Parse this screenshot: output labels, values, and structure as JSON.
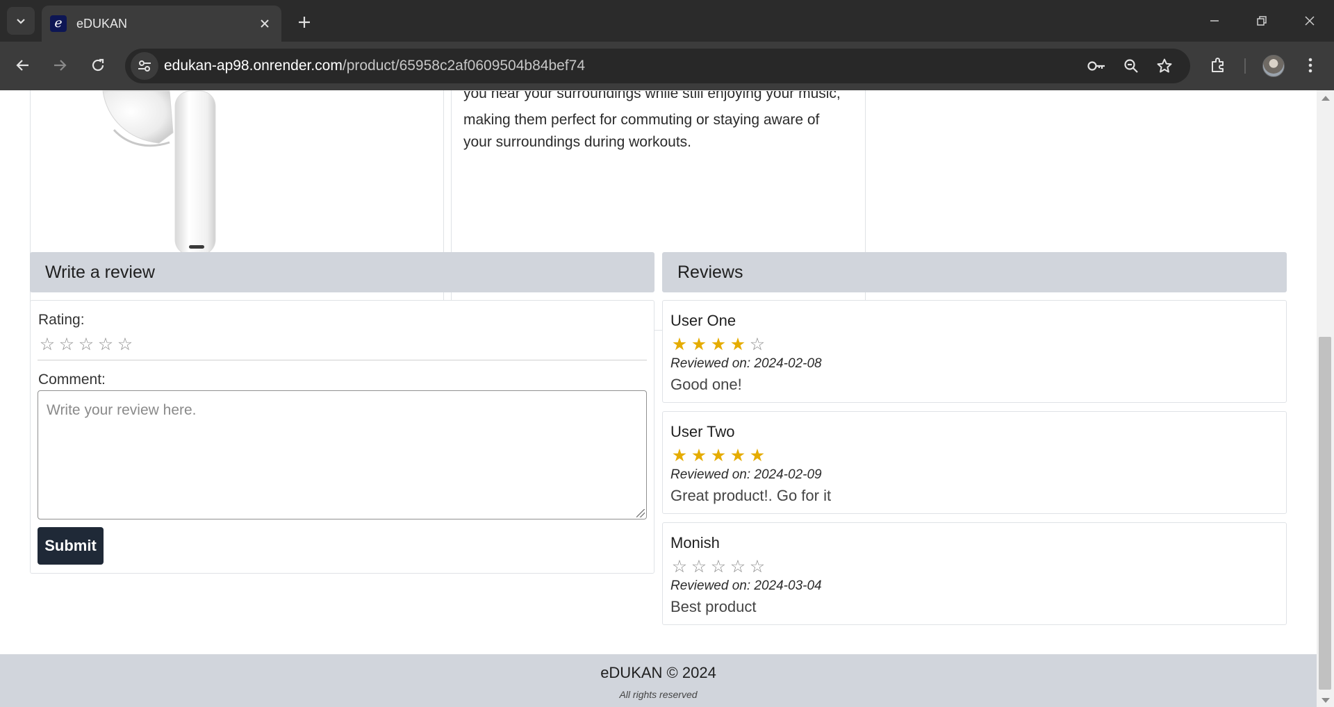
{
  "browser": {
    "tab_title": "eDUKAN",
    "favicon_letter": "e",
    "url_host": "edukan-ap98.onrender.com",
    "url_path": "/product/65958c2af0609504b84bef74"
  },
  "product": {
    "description_lines": [
      "you hear your surroundings while still enjoying your music,",
      "making them perfect for commuting or staying aware of",
      "your surroundings during workouts."
    ]
  },
  "write_review": {
    "header": "Write a review",
    "rating_label": "Rating:",
    "rating_value": 0,
    "comment_label": "Comment:",
    "comment_placeholder": "Write your review here.",
    "submit_label": "Submit"
  },
  "reviews": {
    "header": "Reviews",
    "items": [
      {
        "name": "User One",
        "rating": 4,
        "date": "Reviewed on: 2024-02-08",
        "comment": "Good one!"
      },
      {
        "name": "User Two",
        "rating": 5,
        "date": "Reviewed on: 2024-02-09",
        "comment": "Great product!. Go for it"
      },
      {
        "name": "Monish",
        "rating": 0,
        "date": "Reviewed on: 2024-03-04",
        "comment": "Best product"
      }
    ]
  },
  "footer": {
    "title": "eDUKAN © 2024",
    "subtitle": "All rights reserved"
  },
  "colors": {
    "star_filled": "#e5ac00",
    "star_empty": "#8c8c8c",
    "header_bg": "#d1d5dc",
    "submit_bg": "#1f2937"
  }
}
